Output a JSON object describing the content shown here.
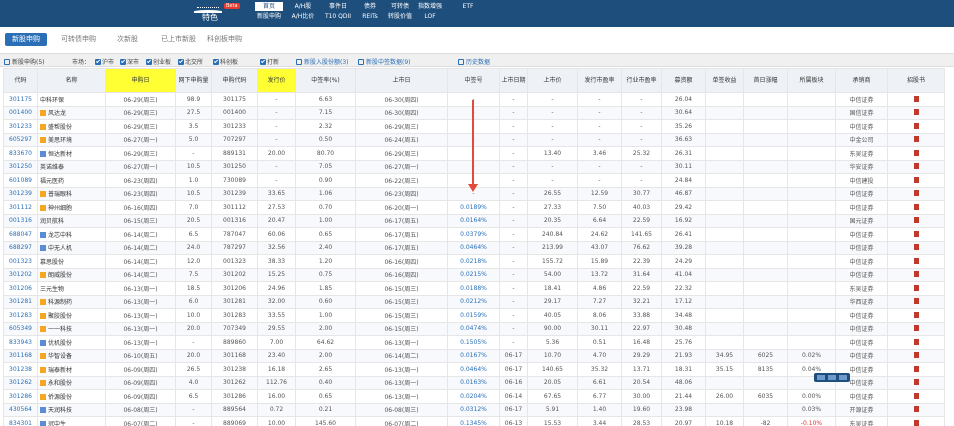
{
  "header": {
    "logo_text": "特色",
    "beta": "Beta",
    "nav": [
      {
        "top": "首页",
        "sub": "新股申购"
      },
      {
        "top": "A/H股",
        "sub": "A/H比价"
      },
      {
        "top": "事件日",
        "sub": "T10 QDII"
      },
      {
        "top": "债券",
        "sub": "REITs"
      },
      {
        "top": "可转债",
        "sub": "转股价值"
      },
      {
        "top": "指数增强",
        "sub": "LOF"
      },
      {
        "top": "ETF",
        "sub": ""
      }
    ]
  },
  "tabs": [
    "新股申购",
    "可转债申购",
    "次新股",
    "已上市新股",
    "科创板申购"
  ],
  "toolbar": {
    "show_all": "新股申购(5)",
    "market_label": "市场：",
    "markets": [
      "沪市",
      "深市",
      "创业板",
      "北交所",
      "科创板",
      "打新"
    ],
    "link1": "新股入股份额(3)",
    "link2": "新股中签数据(9)",
    "link3": "历史数据"
  },
  "columns": [
    "代码",
    "名称",
    "申购日",
    "网下申购量",
    "申购代码",
    "发行价",
    "中签率(%)",
    "上市日",
    "中签号",
    "上市日期",
    "上市价",
    "发行市盈率",
    "行业市盈率",
    "募资额",
    "单签收益",
    "首日涨幅",
    "所属板块",
    "承销商",
    "招股书"
  ],
  "rows": [
    {
      "code": "301175",
      "name": "中科环保",
      "date": "06-29(周三)",
      "q": "98.9",
      "sub": "301175",
      "price": "-",
      "ratio": "6.63",
      "list": "06-30(周四)",
      "rate": "-",
      "c1": "-",
      "c2": "-",
      "c3": "-",
      "c4": "-",
      "pe": "26.04",
      "v1": "",
      "v2": "",
      "v3": "",
      "board": "中信证券",
      "tag": "none"
    },
    {
      "code": "001400",
      "name": "风达龙",
      "date": "06-29(周三)",
      "q": "27.5",
      "sub": "001400",
      "price": "-",
      "ratio": "7.15",
      "list": "06-30(周四)",
      "rate": "-",
      "c1": "-",
      "c2": "-",
      "c3": "-",
      "c4": "-",
      "pe": "30.64",
      "v1": "",
      "v2": "",
      "v3": "",
      "board": "国信证券",
      "tag": "a"
    },
    {
      "code": "301233",
      "name": "盛帮股份",
      "date": "06-29(周三)",
      "q": "3.5",
      "sub": "301233",
      "price": "-",
      "ratio": "2.32",
      "list": "06-29(周三)",
      "rate": "-",
      "c1": "-",
      "c2": "-",
      "c3": "-",
      "c4": "-",
      "pe": "35.26",
      "v1": "",
      "v2": "",
      "v3": "",
      "board": "中信证券",
      "tag": "a"
    },
    {
      "code": "605297",
      "name": "美思环境",
      "date": "06-27(周一)",
      "q": "5.0",
      "sub": "707297",
      "price": "-",
      "ratio": "0.50",
      "list": "06-24(周五)",
      "rate": "-",
      "c1": "-",
      "c2": "-",
      "c3": "-",
      "c4": "-",
      "pe": "36.63",
      "v1": "",
      "v2": "",
      "v3": "",
      "board": "中金公司",
      "tag": "a"
    },
    {
      "code": "833670",
      "name": "恒达新材",
      "date": "06-29(周三)",
      "q": "-",
      "sub": "889131",
      "price": "20.00",
      "ratio": "80.70",
      "list": "06-29(周三)",
      "rate": "-",
      "c1": "-",
      "c2": "13.40",
      "c3": "3.46",
      "c4": "25.32",
      "pe": "26.31",
      "v1": "",
      "v2": "",
      "v3": "",
      "board": "东吴证券",
      "tag": "blue"
    },
    {
      "code": "301250",
      "name": "英诺维泰",
      "date": "06-27(周一)",
      "q": "10.5",
      "sub": "301250",
      "price": "-",
      "ratio": "7.05",
      "list": "06-27(周一)",
      "rate": "-",
      "c1": "-",
      "c2": "-",
      "c3": "-",
      "c4": "-",
      "pe": "30.11",
      "v1": "",
      "v2": "",
      "v3": "",
      "board": "华安证券",
      "tag": "none"
    },
    {
      "code": "601089",
      "name": "福元医药",
      "date": "06-23(周四)",
      "q": "1.0",
      "sub": "730089",
      "price": "-",
      "ratio": "0.90",
      "list": "06-22(周三)",
      "rate": "-",
      "c1": "-",
      "c2": "-",
      "c3": "-",
      "c4": "-",
      "pe": "24.84",
      "v1": "",
      "v2": "",
      "v3": "",
      "board": "中信建投",
      "tag": "none"
    },
    {
      "code": "301239",
      "name": "普瑞眼科",
      "date": "06-23(周四)",
      "q": "10.5",
      "sub": "301239",
      "price": "33.65",
      "ratio": "1.06",
      "list": "06-23(周四)",
      "rate": "-",
      "c1": "-",
      "c2": "26.55",
      "c3": "12.59",
      "c4": "30.77",
      "pe": "46.87",
      "v1": "",
      "v2": "",
      "v3": "",
      "board": "中信证券",
      "tag": "a"
    },
    {
      "code": "301112",
      "name": "神州细胞",
      "date": "06-16(周四)",
      "q": "7.0",
      "sub": "301112",
      "price": "27.53",
      "ratio": "0.70",
      "list": "06-20(周一)",
      "rate": "0.0189%",
      "c1": "-",
      "c2": "27.33",
      "c3": "7.50",
      "c4": "40.03",
      "pe": "29.42",
      "v1": "",
      "v2": "",
      "v3": "",
      "board": "中信证券",
      "tag": "a"
    },
    {
      "code": "001316",
      "name": "润贝航科",
      "date": "06-15(周三)",
      "q": "20.5",
      "sub": "001316",
      "price": "20.47",
      "ratio": "1.00",
      "list": "06-17(周五)",
      "rate": "0.0164%",
      "c1": "-",
      "c2": "20.35",
      "c3": "6.64",
      "c4": "22.59",
      "pe": "16.92",
      "v1": "",
      "v2": "",
      "v3": "",
      "board": "国元证券",
      "tag": "none"
    },
    {
      "code": "688047",
      "name": "龙芯中科",
      "date": "06-14(周二)",
      "q": "6.5",
      "sub": "787047",
      "price": "60.06",
      "ratio": "0.65",
      "list": "06-17(周五)",
      "rate": "0.0379%",
      "c1": "-",
      "c2": "240.84",
      "c3": "24.62",
      "c4": "141.65",
      "pe": "26.41",
      "v1": "",
      "v2": "",
      "v3": "",
      "board": "中信证券",
      "tag": "blue"
    },
    {
      "code": "688297",
      "name": "中无人机",
      "date": "06-14(周二)",
      "q": "24.0",
      "sub": "787297",
      "price": "32.56",
      "ratio": "2.40",
      "list": "06-17(周五)",
      "rate": "0.0464%",
      "c1": "-",
      "c2": "213.99",
      "c3": "43.07",
      "c4": "76.62",
      "pe": "39.28",
      "v1": "",
      "v2": "",
      "v3": "",
      "board": "中信证券",
      "tag": "blue"
    },
    {
      "code": "001323",
      "name": "慕思股份",
      "date": "06-14(周二)",
      "q": "12.0",
      "sub": "001323",
      "price": "38.33",
      "ratio": "1.20",
      "list": "06-16(周四)",
      "rate": "0.0218%",
      "c1": "-",
      "c2": "155.72",
      "c3": "15.89",
      "c4": "22.39",
      "pe": "24.29",
      "v1": "",
      "v2": "",
      "v3": "",
      "board": "中信证券",
      "tag": "none"
    },
    {
      "code": "301202",
      "name": "朗威股份",
      "date": "06-14(周二)",
      "q": "7.5",
      "sub": "301202",
      "price": "15.25",
      "ratio": "0.75",
      "list": "06-16(周四)",
      "rate": "0.0215%",
      "c1": "-",
      "c2": "54.00",
      "c3": "13.72",
      "c4": "31.64",
      "pe": "41.04",
      "v1": "",
      "v2": "",
      "v3": "",
      "board": "中信证券",
      "tag": "a"
    },
    {
      "code": "301206",
      "name": "三元生物",
      "date": "06-13(周一)",
      "q": "18.5",
      "sub": "301206",
      "price": "24.96",
      "ratio": "1.85",
      "list": "06-15(周三)",
      "rate": "0.0188%",
      "c1": "-",
      "c2": "18.41",
      "c3": "4.86",
      "c4": "22.59",
      "pe": "22.32",
      "v1": "",
      "v2": "",
      "v3": "",
      "board": "东吴证券",
      "tag": "none"
    },
    {
      "code": "301281",
      "name": "科源制药",
      "date": "06-13(周一)",
      "q": "6.0",
      "sub": "301281",
      "price": "32.00",
      "ratio": "0.60",
      "list": "06-15(周三)",
      "rate": "0.0212%",
      "c1": "-",
      "c2": "29.17",
      "c3": "7.27",
      "c4": "32.21",
      "pe": "17.12",
      "v1": "",
      "v2": "",
      "v3": "",
      "board": "华西证券",
      "tag": "a"
    },
    {
      "code": "301283",
      "name": "聚胶股份",
      "date": "06-13(周一)",
      "q": "10.0",
      "sub": "301283",
      "price": "33.55",
      "ratio": "1.00",
      "list": "06-15(周三)",
      "rate": "0.0159%",
      "c1": "-",
      "c2": "40.05",
      "c3": "8.06",
      "c4": "33.88",
      "pe": "34.48",
      "v1": "",
      "v2": "",
      "v3": "",
      "board": "中信证券",
      "tag": "a"
    },
    {
      "code": "605349",
      "name": "一一科技",
      "date": "06-13(周一)",
      "q": "20.0",
      "sub": "707349",
      "price": "29.55",
      "ratio": "2.00",
      "list": "06-15(周三)",
      "rate": "0.0474%",
      "c1": "-",
      "c2": "90.00",
      "c3": "30.11",
      "c4": "22.97",
      "pe": "30.48",
      "v1": "",
      "v2": "",
      "v3": "",
      "board": "中信证券",
      "tag": "a"
    },
    {
      "code": "833943",
      "name": "优机股份",
      "date": "06-13(周一)",
      "q": "-",
      "sub": "889860",
      "price": "7.00",
      "ratio": "64.62",
      "list": "06-13(周一)",
      "rate": "0.1505%",
      "c1": "-",
      "c2": "5.36",
      "c3": "0.51",
      "c4": "16.48",
      "pe": "25.76",
      "v1": "",
      "v2": "",
      "v3": "",
      "board": "中信证券",
      "tag": "blue"
    },
    {
      "code": "301168",
      "name": "华智设备",
      "date": "06-10(周五)",
      "q": "20.0",
      "sub": "301168",
      "price": "23.40",
      "ratio": "2.00",
      "list": "06-14(周二)",
      "rate": "0.0167%",
      "c1": "06-17",
      "c2": "10.70",
      "c3": "4.70",
      "c4": "29.29",
      "pe": "21.93",
      "v1": "34.95",
      "v2": "6025",
      "v3": "0.02%",
      "board": "中信证券",
      "tag": "a"
    },
    {
      "code": "301238",
      "name": "瑞泰新材",
      "date": "06-09(周四)",
      "q": "26.5",
      "sub": "301238",
      "price": "16.18",
      "ratio": "2.65",
      "list": "06-13(周一)",
      "rate": "0.0464%",
      "c1": "06-17",
      "c2": "140.65",
      "c3": "35.32",
      "c4": "13.71",
      "pe": "18.31",
      "v1": "35.15",
      "v2": "8135",
      "v3": "0.04%",
      "board": "中信证券",
      "tag": "a"
    },
    {
      "code": "301262",
      "name": "永和股份",
      "date": "06-09(周四)",
      "q": "4.0",
      "sub": "301262",
      "price": "112.76",
      "ratio": "0.40",
      "list": "06-13(周一)",
      "rate": "0.0163%",
      "c1": "06-16",
      "c2": "20.05",
      "c3": "6.61",
      "c4": "20.54",
      "pe": "48.06",
      "v1": "",
      "v2": "",
      "v3": "",
      "board": "中信证券",
      "tag": "a"
    },
    {
      "code": "301286",
      "name": "侨源股份",
      "date": "06-09(周四)",
      "q": "6.5",
      "sub": "301286",
      "price": "16.00",
      "ratio": "0.65",
      "list": "06-13(周一)",
      "rate": "0.0204%",
      "c1": "06-14",
      "c2": "67.65",
      "c3": "6.77",
      "c4": "30.00",
      "pe": "21.44",
      "v1": "26.00",
      "v2": "6035",
      "v3": "0.00%",
      "board": "中信证券",
      "tag": "a"
    },
    {
      "code": "430564",
      "name": "天润科技",
      "date": "06-08(周三)",
      "q": "-",
      "sub": "889564",
      "price": "0.72",
      "ratio": "0.21",
      "list": "06-08(周三)",
      "rate": "0.0312%",
      "c1": "06-17",
      "c2": "5.91",
      "c3": "1.40",
      "c4": "19.60",
      "pe": "23.98",
      "v1": "",
      "v2": "",
      "v3": "0.03%",
      "board": "开源证券",
      "tag": "blue"
    },
    {
      "code": "834301",
      "name": "冠中生",
      "date": "06-07(周二)",
      "q": "-",
      "sub": "889069",
      "price": "10.00",
      "ratio": "145.60",
      "list": "06-07(周二)",
      "rate": "0.1345%",
      "c1": "06-13",
      "c2": "15.53",
      "c3": "3.44",
      "c4": "28.53",
      "pe": "20.97",
      "v1": "10.18",
      "v2": "-82",
      "v3": "-0.10%",
      "board": "东吴证券",
      "tag": "blue"
    }
  ]
}
